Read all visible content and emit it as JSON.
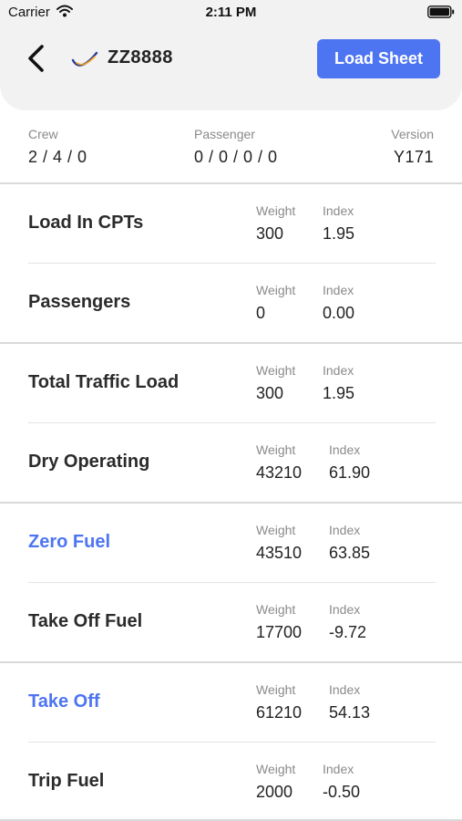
{
  "status_bar": {
    "carrier": "Carrier",
    "time": "2:11 PM"
  },
  "header": {
    "flight_number": "ZZ8888",
    "load_sheet_label": "Load Sheet",
    "accent_color": "#4d74f1"
  },
  "summary": {
    "crew": {
      "label": "Crew",
      "value": "2 / 4 / 0"
    },
    "passenger": {
      "label": "Passenger",
      "value": "0 / 0 / 0 / 0"
    },
    "version": {
      "label": "Version",
      "value": "Y171"
    }
  },
  "rows": [
    {
      "title": "Load In CPTs",
      "weight_label": "Weight",
      "index_label": "Index",
      "weight": "300",
      "index": "1.95",
      "highlight": false
    },
    {
      "title": "Passengers",
      "weight_label": "Weight",
      "index_label": "Index",
      "weight": "0",
      "index": "0.00",
      "highlight": false
    },
    {
      "title": "Total Traffic Load",
      "weight_label": "Weight",
      "index_label": "Index",
      "weight": "300",
      "index": "1.95",
      "highlight": false
    },
    {
      "title": "Dry Operating",
      "weight_label": "Weight",
      "index_label": "Index",
      "weight": "43210",
      "index": "61.90",
      "highlight": false
    },
    {
      "title": "Zero Fuel",
      "weight_label": "Weight",
      "index_label": "Index",
      "weight": "43510",
      "index": "63.85",
      "highlight": true
    },
    {
      "title": "Take Off Fuel",
      "weight_label": "Weight",
      "index_label": "Index",
      "weight": "17700",
      "index": "-9.72",
      "highlight": false
    },
    {
      "title": "Take Off",
      "weight_label": "Weight",
      "index_label": "Index",
      "weight": "61210",
      "index": "54.13",
      "highlight": true
    },
    {
      "title": "Trip Fuel",
      "weight_label": "Weight",
      "index_label": "Index",
      "weight": "2000",
      "index": "-0.50",
      "highlight": false
    }
  ]
}
